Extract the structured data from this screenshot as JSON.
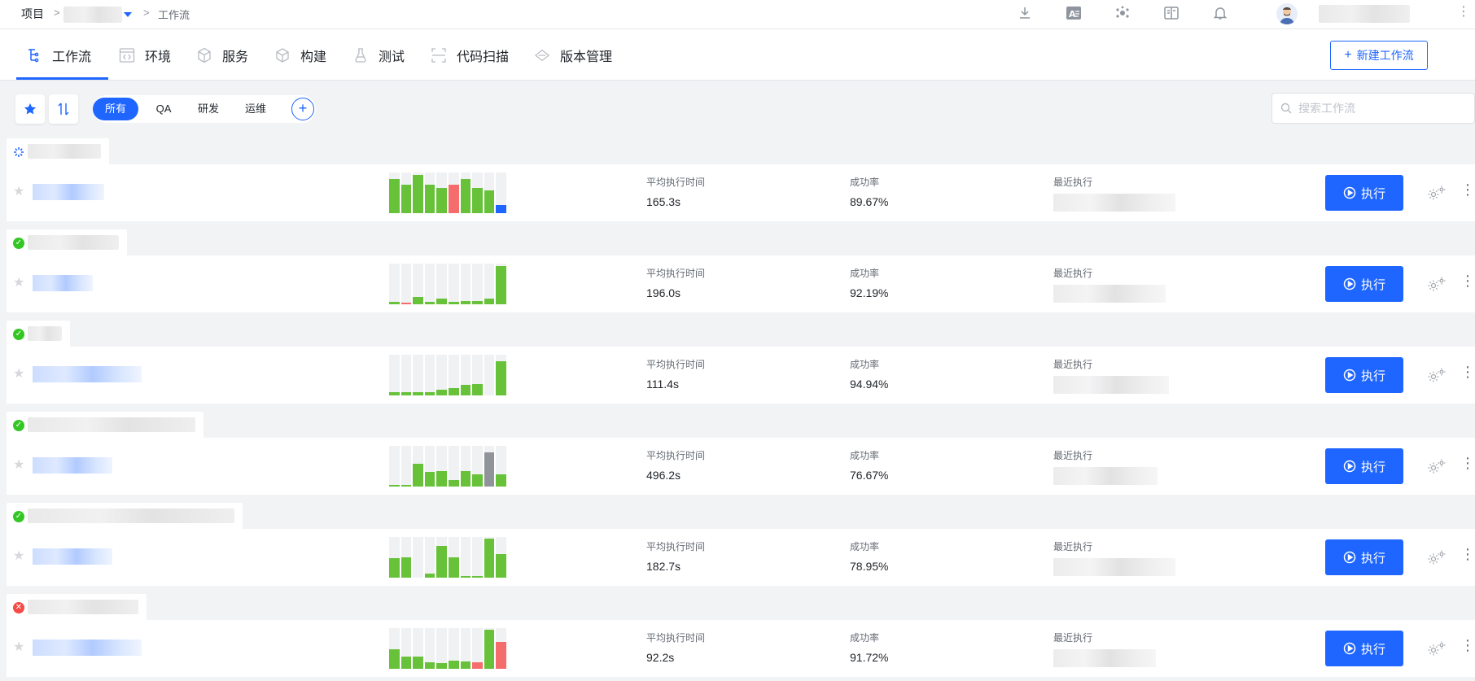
{
  "header": {
    "crumb_root": "项目",
    "crumb_sep": ">",
    "crumb_current": "工作流"
  },
  "tabs": [
    {
      "label": "工作流",
      "icon": "workflow-icon"
    },
    {
      "label": "环境",
      "icon": "environment-icon"
    },
    {
      "label": "服务",
      "icon": "service-icon"
    },
    {
      "label": "构建",
      "icon": "build-icon"
    },
    {
      "label": "测试",
      "icon": "test-icon"
    },
    {
      "label": "代码扫描",
      "icon": "code-scan-icon"
    },
    {
      "label": "版本管理",
      "icon": "version-icon"
    }
  ],
  "new_workflow_label": "新建工作流",
  "filters": {
    "options": [
      "所有",
      "QA",
      "研发",
      "运维"
    ],
    "active": "所有"
  },
  "search": {
    "placeholder": "搜索工作流"
  },
  "labels": {
    "avg_time": "平均执行时间",
    "success_rate": "成功率",
    "recent": "最近执行",
    "run": "执行"
  },
  "colors": {
    "accent": "#1e66ff",
    "success": "#67c23a",
    "failure": "#f56c6c",
    "running": "#1e66ff",
    "cancelled": "#909399",
    "empty": "#f0f1f3"
  },
  "workflows": [
    {
      "status": "running",
      "avg_time": "165.3s",
      "success_rate": "89.67%",
      "history": [
        {
          "h": 0.84,
          "s": "success"
        },
        {
          "h": 0.7,
          "s": "success"
        },
        {
          "h": 0.93,
          "s": "success"
        },
        {
          "h": 0.7,
          "s": "success"
        },
        {
          "h": 0.62,
          "s": "success"
        },
        {
          "h": 0.7,
          "s": "failure"
        },
        {
          "h": 0.84,
          "s": "success"
        },
        {
          "h": 0.62,
          "s": "success"
        },
        {
          "h": 0.56,
          "s": "success"
        },
        {
          "h": 0.2,
          "s": "running"
        }
      ]
    },
    {
      "status": "success",
      "avg_time": "196.0s",
      "success_rate": "92.19%",
      "history": [
        {
          "h": 0.05,
          "s": "success"
        },
        {
          "h": 0.04,
          "s": "failure"
        },
        {
          "h": 0.18,
          "s": "success"
        },
        {
          "h": 0.05,
          "s": "success"
        },
        {
          "h": 0.14,
          "s": "success"
        },
        {
          "h": 0.06,
          "s": "success"
        },
        {
          "h": 0.08,
          "s": "success"
        },
        {
          "h": 0.07,
          "s": "success"
        },
        {
          "h": 0.13,
          "s": "success"
        },
        {
          "h": 0.93,
          "s": "success"
        }
      ]
    },
    {
      "status": "success",
      "avg_time": "111.4s",
      "success_rate": "94.94%",
      "history": [
        {
          "h": 0.08,
          "s": "success"
        },
        {
          "h": 0.08,
          "s": "success"
        },
        {
          "h": 0.08,
          "s": "success"
        },
        {
          "h": 0.08,
          "s": "success"
        },
        {
          "h": 0.13,
          "s": "success"
        },
        {
          "h": 0.18,
          "s": "success"
        },
        {
          "h": 0.25,
          "s": "success"
        },
        {
          "h": 0.28,
          "s": "success"
        },
        {
          "h": 0.0,
          "s": "success"
        },
        {
          "h": 0.84,
          "s": "success"
        }
      ]
    },
    {
      "status": "success",
      "avg_time": "496.2s",
      "success_rate": "76.67%",
      "history": [
        {
          "h": 0.04,
          "s": "success"
        },
        {
          "h": 0.04,
          "s": "success"
        },
        {
          "h": 0.56,
          "s": "success"
        },
        {
          "h": 0.35,
          "s": "success"
        },
        {
          "h": 0.38,
          "s": "success"
        },
        {
          "h": 0.16,
          "s": "success"
        },
        {
          "h": 0.38,
          "s": "success"
        },
        {
          "h": 0.3,
          "s": "success"
        },
        {
          "h": 0.84,
          "s": "cancelled"
        },
        {
          "h": 0.3,
          "s": "success"
        }
      ]
    },
    {
      "status": "success",
      "avg_time": "182.7s",
      "success_rate": "78.95%",
      "history": [
        {
          "h": 0.48,
          "s": "success"
        },
        {
          "h": 0.5,
          "s": "success"
        },
        {
          "h": 0.0,
          "s": "success"
        },
        {
          "h": 0.1,
          "s": "success"
        },
        {
          "h": 0.78,
          "s": "success"
        },
        {
          "h": 0.5,
          "s": "success"
        },
        {
          "h": 0.03,
          "s": "success"
        },
        {
          "h": 0.03,
          "s": "success"
        },
        {
          "h": 0.96,
          "s": "success"
        },
        {
          "h": 0.58,
          "s": "success"
        }
      ]
    },
    {
      "status": "failure",
      "avg_time": "92.2s",
      "success_rate": "91.72%",
      "history": [
        {
          "h": 0.48,
          "s": "success"
        },
        {
          "h": 0.3,
          "s": "success"
        },
        {
          "h": 0.3,
          "s": "success"
        },
        {
          "h": 0.15,
          "s": "success"
        },
        {
          "h": 0.13,
          "s": "success"
        },
        {
          "h": 0.2,
          "s": "success"
        },
        {
          "h": 0.18,
          "s": "success"
        },
        {
          "h": 0.15,
          "s": "failure"
        },
        {
          "h": 0.96,
          "s": "success"
        },
        {
          "h": 0.66,
          "s": "failure"
        }
      ]
    }
  ]
}
